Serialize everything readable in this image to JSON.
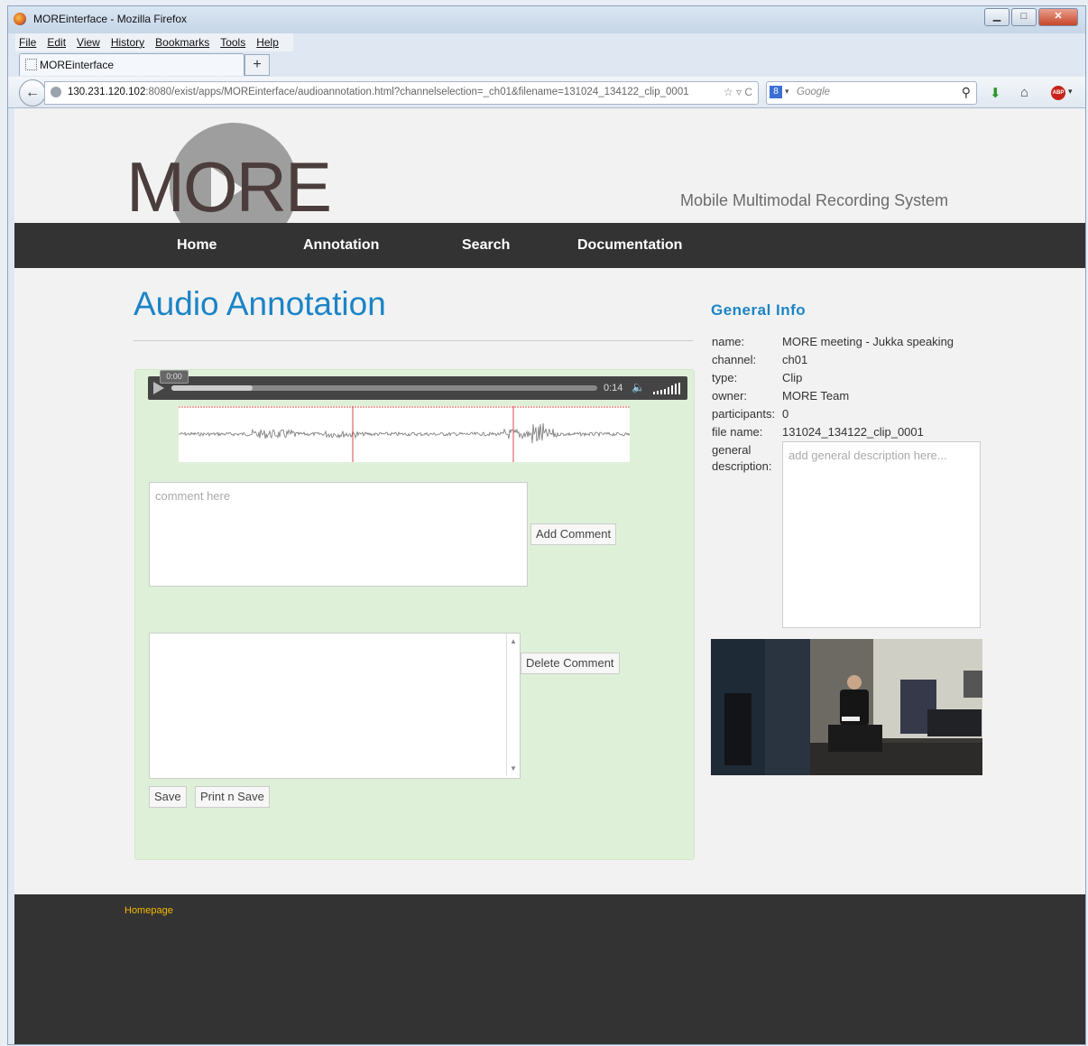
{
  "browser": {
    "window_title": "MOREinterface - Mozilla Firefox",
    "menu": [
      "File",
      "Edit",
      "View",
      "History",
      "Bookmarks",
      "Tools",
      "Help"
    ],
    "tab_label": "MOREinterface",
    "url_host": "130.231.120.102",
    "url_rest": ":8080/exist/apps/MOREinterface/audioannotation.html?channelselection=_ch01&filename=131024_134122_clip_0001",
    "search_placeholder": "Google"
  },
  "site": {
    "logo_text": "MORE",
    "tagline": "Mobile Multimodal Recording System",
    "nav": [
      "Home",
      "Annotation",
      "Search",
      "Documentation"
    ]
  },
  "annotation": {
    "heading": "Audio Annotation",
    "player": {
      "current_time": "0:00",
      "duration": "0:14",
      "progress": 0.0,
      "buffered": 0.19
    },
    "comment_placeholder": "comment here",
    "add_comment": "Add Comment",
    "delete_comment": "Delete Comment",
    "save": "Save",
    "print_save": "Print n Save"
  },
  "general_info": {
    "heading": "General Info",
    "fields": [
      {
        "label": "name:",
        "value": "MORE meeting - Jukka speaking"
      },
      {
        "label": "channel:",
        "value": "ch01"
      },
      {
        "label": "type:",
        "value": "Clip"
      },
      {
        "label": "owner:",
        "value": "MORE Team"
      },
      {
        "label": "participants:",
        "value": "0"
      },
      {
        "label": "file name:",
        "value": "131024_134122_clip_0001"
      }
    ],
    "desc_label_1": "general",
    "desc_label_2": "description:",
    "desc_placeholder": "add general description here..."
  },
  "footer": {
    "link": "Homepage"
  },
  "colors": {
    "accent": "#1b84c7",
    "nav_bg": "#333333",
    "panel_bg": "#dff0d8",
    "footer_link": "#f5b800"
  }
}
